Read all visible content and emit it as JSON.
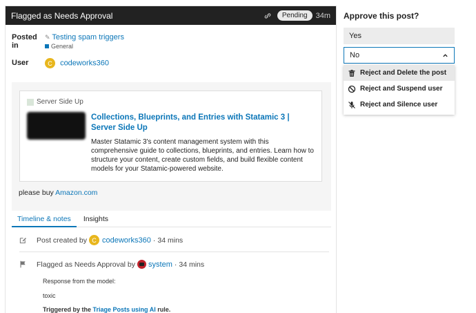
{
  "header": {
    "title": "Flagged as Needs Approval",
    "status": "Pending",
    "age": "34m"
  },
  "meta": {
    "posted_in_label": "Posted in",
    "topic": "Testing spam triggers",
    "category": "General",
    "user_label": "User",
    "username": "codeworks360",
    "avatar_letter": "C"
  },
  "onebox": {
    "site": "Server Side Up",
    "title": "Collections, Blueprints, and Entries with Statamic 3 | Server Side Up",
    "description": "Master Statamic 3's content management system with this comprehensive guide to collections, blueprints, and entries. Learn how to structure your content, create custom fields, and build flexible content models for your Statamic-powered website."
  },
  "post": {
    "text": "please buy",
    "link": "Amazon.com"
  },
  "tabs": [
    {
      "label": "Timeline & notes"
    },
    {
      "label": "Insights"
    }
  ],
  "timeline": {
    "created": {
      "prefix": "Post created by",
      "user": "codeworks360",
      "sep": "·",
      "time": "34 mins"
    },
    "flagged": {
      "prefix": "Flagged as Needs Approval by",
      "user": "system",
      "sep": "·",
      "time": "34 mins"
    },
    "response_label": "Response from the model:",
    "response": "toxic",
    "triggered_prefix": "Triggered by the",
    "rule_name": "Triage Posts using AI",
    "triggered_suffix": "rule."
  },
  "approve": {
    "title": "Approve this post?",
    "yes": "Yes",
    "no": "No",
    "menu": [
      {
        "label": "Reject and Delete the post",
        "icon": "trash-icon"
      },
      {
        "label": "Reject and Suspend user",
        "icon": "ban-icon"
      },
      {
        "label": "Reject and Silence user",
        "icon": "microphone-slash-icon"
      }
    ]
  },
  "colors": {
    "accent": "#0b76b8",
    "header_bg": "#222222",
    "avatar": "#e8b61d"
  }
}
